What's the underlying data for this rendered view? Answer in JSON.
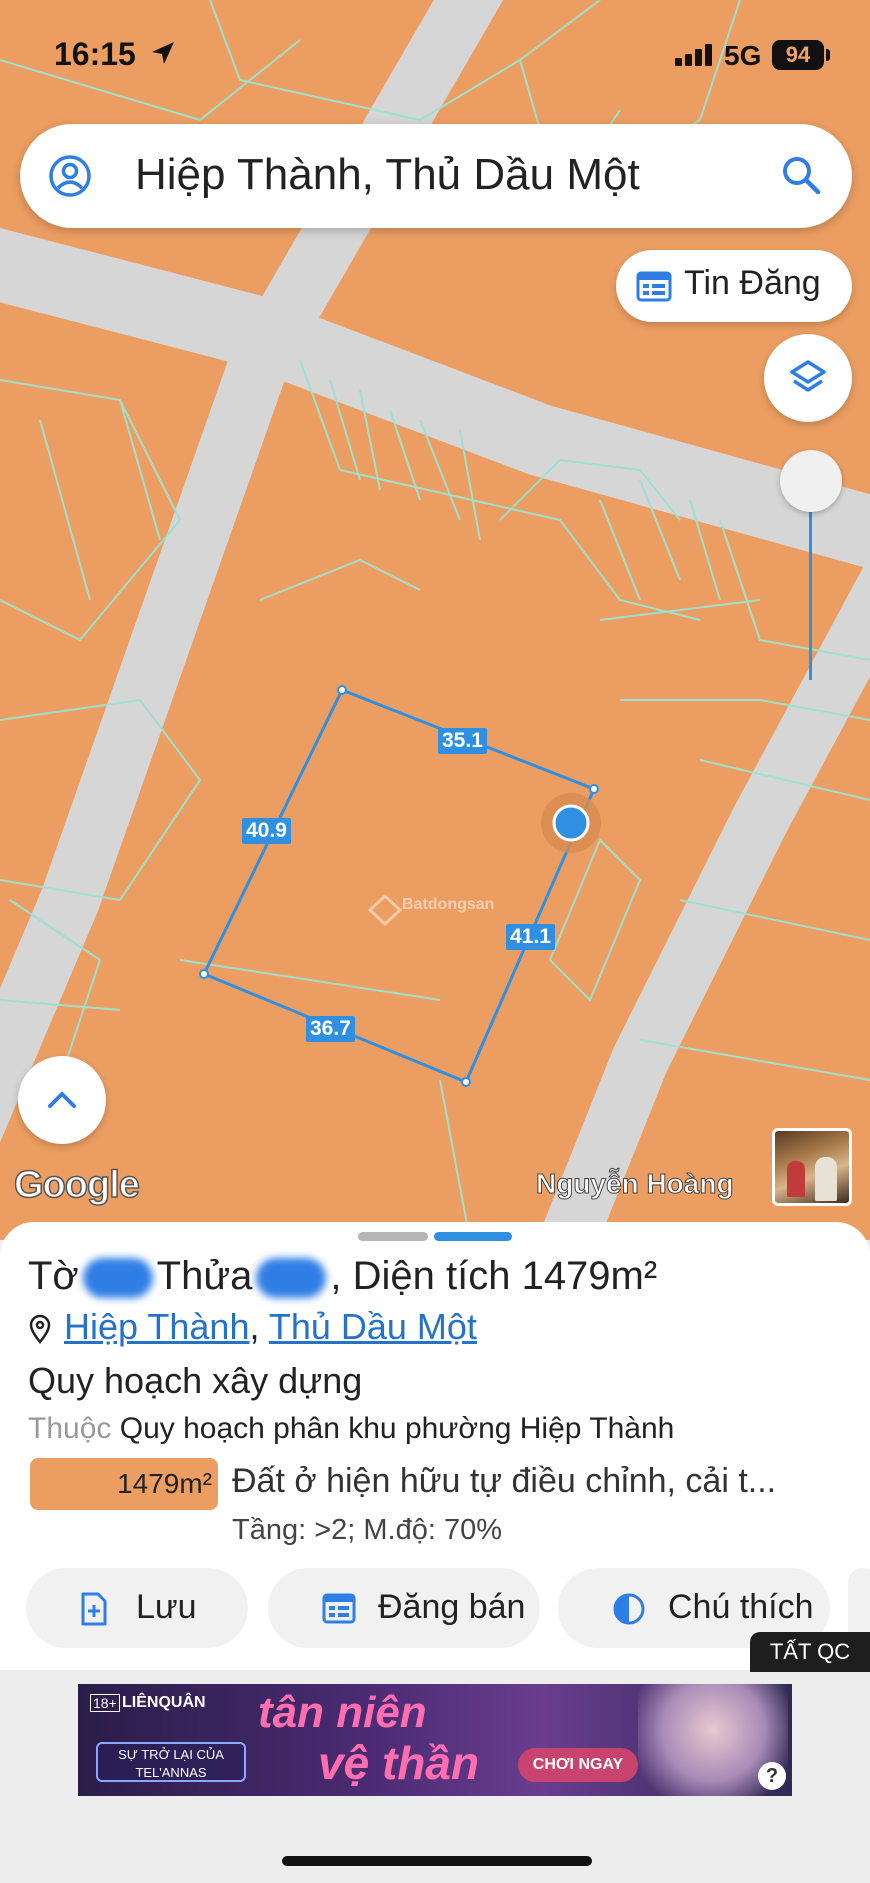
{
  "status_bar": {
    "time": "16:15",
    "network": "5G",
    "battery": "94"
  },
  "search": {
    "query": "Hiệp Thành, Thủ Dầu Một"
  },
  "buttons": {
    "tin_dang": "Tin Đăng"
  },
  "map": {
    "attribution": "Google",
    "author": "Nguyễn Hoàng",
    "edge_lengths": [
      "35.1",
      "41.1",
      "36.7",
      "40.9"
    ],
    "watermark": "Batdongsan"
  },
  "sheet": {
    "to_label": "Tờ",
    "thua_label": "Thửa",
    "area_text": ", Diện tích 1479m²",
    "ward": "Hiệp Thành",
    "city": "Thủ Dầu Một",
    "section_title": "Quy hoạch xây dựng",
    "belongs_prefix": "Thuộc",
    "belongs_value": "Quy hoạch phân khu phường Hiệp Thành",
    "zone_area": "1479m²",
    "zone_description": "Đất ở hiện hữu tự điều chỉnh, cải t...",
    "zone_rules": "Tầng: >2; M.độ: 70%",
    "zone_color": "#ec9e62",
    "actions": [
      {
        "label": "Lưu",
        "icon": "add-file-icon"
      },
      {
        "label": "Đăng bán",
        "icon": "calendar-icon"
      },
      {
        "label": "Chú thích",
        "icon": "half-circle-icon"
      }
    ]
  },
  "ads": {
    "close_label": "TẤT QC",
    "banner_brand": "LIÊNQUÂN",
    "banner_age": "18+",
    "banner_return": "SỰ TRỞ LẠI CỦA TEL'ANNAS",
    "banner_line1": "tân niên",
    "banner_line2": "vệ thần",
    "banner_cta": "CHƠI NGAY"
  },
  "colors": {
    "accent": "#2f8fe0",
    "map_fill": "#ec9e62",
    "road": "#d4d4d4",
    "parcel_line": "#9be3d1"
  }
}
